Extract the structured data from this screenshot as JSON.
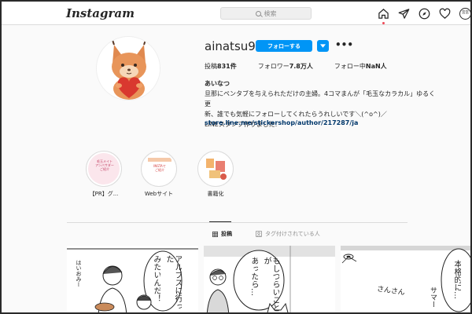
{
  "app": {
    "logo": "Instagram",
    "search_placeholder": "検索",
    "nav_avatar_text": "宮宮"
  },
  "profile": {
    "username": "ainatsu9",
    "follow_label": "フォローする",
    "posts_label": "投稿",
    "posts_count": "831件",
    "followers_label": "フォロワー",
    "followers_count": "7.8万人",
    "following_label": "フォロー中",
    "following_count": "NaN人",
    "full_name": "あいなつ",
    "bio_line1": "旦那にペンタブを与えられただけの主婦。4コマまんが「毛玉なカラカル」ゆるく更",
    "bio_line2": "新、誰でも気軽にフォローしてくれたらうれしいです＼(^o^)／",
    "bio_line3": "LINEスタンプ作りました:",
    "link": "store.line.me/stickershop/author/217287/ja"
  },
  "highlights": [
    {
      "label": "【PR】グ...",
      "thumb_text_1": "毛玉メイト",
      "thumb_text_2": "アンバサダー",
      "thumb_text_3": "ご紹介"
    },
    {
      "label": "Webサイト",
      "thumb_text_1": "INSTAで",
      "thumb_text_2": "ご紹介",
      "thumb_text_3": ""
    },
    {
      "label": "書籍化",
      "thumb_text_1": "",
      "thumb_text_2": "",
      "thumb_text_3": ""
    }
  ],
  "tabs": {
    "posts": "投稿",
    "tagged": "タグ付けされている人"
  },
  "posts": [
    {
      "text_1": "はいおみー",
      "text_2": "アルプスに行った",
      "text_3": "みたいんだ！"
    },
    {
      "text_1": "もしつらいことが",
      "text_2": "あったら…"
    },
    {
      "text_1": "本格的に…",
      "text_2": "さんさん",
      "text_3": "サマー"
    }
  ],
  "colors": {
    "accent": "#0095f6",
    "link": "#00376b",
    "notification": "#ed4956"
  }
}
